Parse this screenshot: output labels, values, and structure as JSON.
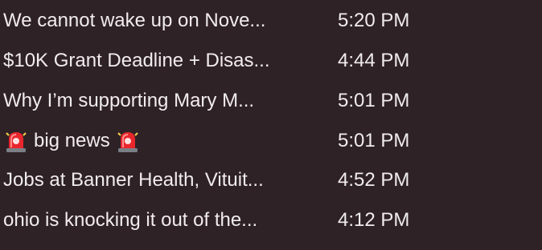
{
  "messages": [
    {
      "subject": "We cannot wake up on Nove...",
      "time": "5:20 PM"
    },
    {
      "subject": "$10K Grant Deadline + Disas...",
      "time": "4:44 PM"
    },
    {
      "subject": "Why I’m supporting Mary M...",
      "time": "5:01 PM"
    },
    {
      "subject": "big news",
      "time": "5:01 PM",
      "leading_icon": "police-light-icon",
      "trailing_icon": "police-light-icon"
    },
    {
      "subject": "Jobs at Banner Health, Vituit...",
      "time": "4:52 PM"
    },
    {
      "subject": "ohio is knocking it out of the...",
      "time": "4:12 PM"
    }
  ],
  "colors": {
    "background": "#2e2226",
    "text": "#f1ecee",
    "siren_red": "#e8262c"
  }
}
